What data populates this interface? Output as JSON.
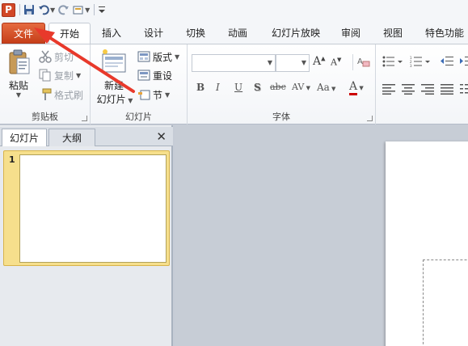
{
  "app": {
    "logo_letter": "P"
  },
  "quick_access": {
    "save_icon": "save-icon",
    "undo_icon": "undo-icon",
    "redo_icon": "redo-icon",
    "new_slide_icon": "new-slide-icon",
    "customize_icon": "customize-icon"
  },
  "tabs": [
    {
      "label": "文件"
    },
    {
      "label": "开始"
    },
    {
      "label": "插入"
    },
    {
      "label": "设计"
    },
    {
      "label": "切换"
    },
    {
      "label": "动画"
    },
    {
      "label": "幻灯片放映"
    },
    {
      "label": "审阅"
    },
    {
      "label": "视图"
    },
    {
      "label": "特色功能"
    }
  ],
  "ribbon": {
    "clipboard": {
      "label": "剪贴板",
      "paste": "粘贴",
      "cut": "剪切",
      "copy": "复制",
      "format_painter": "格式刷"
    },
    "slides": {
      "label": "幻灯片",
      "new_slide_top": "新建",
      "new_slide_bottom": "幻灯片",
      "layout": "版式",
      "reset": "重设",
      "section": "节"
    },
    "font": {
      "label": "字体",
      "bold": "B",
      "italic": "I",
      "underline": "U",
      "shadow": "S",
      "strike": "abc",
      "spacing": "AV",
      "case": "Aa",
      "color": "A",
      "grow": "A",
      "shrink": "A"
    }
  },
  "slide_panel": {
    "tab_slides": "幻灯片",
    "tab_outline": "大纲",
    "close": "✕",
    "thumbnail_number": "1"
  },
  "colors": {
    "file_tab": "#d24726",
    "arrow": "#e8392b",
    "selection": "#f6df8c"
  }
}
